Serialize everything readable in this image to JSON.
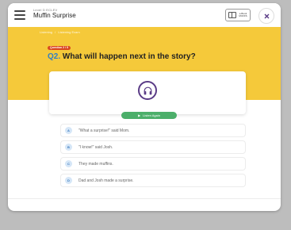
{
  "header": {
    "level": "Level D ECLEV",
    "title": "Muffin Surprise",
    "ebook_label_line1": "e-Book",
    "ebook_label_line2": "MUFFS",
    "menu_icon": "hamburger-menu-icon",
    "close_icon": "close-icon"
  },
  "breadcrumb": {
    "item1": "Listening",
    "separator": "/",
    "item2": "Listening Exam"
  },
  "question": {
    "count": "Question 2 / 5",
    "number": "Q2.",
    "text": "What will happen next in the story?"
  },
  "audio": {
    "icon": "headphones-icon",
    "listen_label": "Listen Again"
  },
  "answers": [
    {
      "letter": "A",
      "text": "\"What a surprise!\" said Mom."
    },
    {
      "letter": "B",
      "text": "\"I know!\" said Josh."
    },
    {
      "letter": "C",
      "text": "They made muffins."
    },
    {
      "letter": "D",
      "text": "Dad and Josh made a surprise."
    }
  ],
  "colors": {
    "banner": "#f5c93a",
    "accent_green": "#4caf6a",
    "question_number": "#2f7ec7",
    "audio_icon": "#5a3b86"
  }
}
